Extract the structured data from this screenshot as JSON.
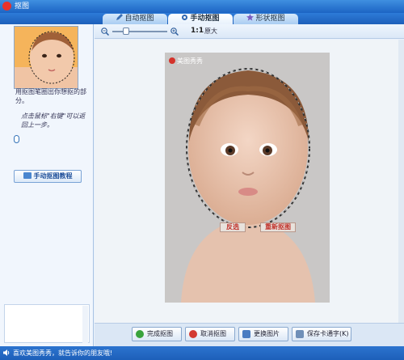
{
  "window": {
    "title": "抠图"
  },
  "tabs": [
    {
      "label": "自动抠图",
      "icon": "pen-icon"
    },
    {
      "label": "手动抠图",
      "icon": "hand-icon"
    },
    {
      "label": "形状抠图",
      "icon": "shape-icon"
    }
  ],
  "sidebar": {
    "hint_draw": "用抠图笔圈出你想抠的部分。",
    "hint_mouse": "点击鼠标\"右键\"可以返回上一步。",
    "tutorial_button": "手动抠图教程"
  },
  "toolbar": {
    "ratio": "1:1",
    "original": "原大"
  },
  "photo": {
    "watermark": "美图秀秀",
    "invert_button": "反选",
    "reset_button": "重新抠图"
  },
  "bottom": {
    "done_button": "完成抠图",
    "cancel_button": "取消抠图",
    "replace_button": "更换图片",
    "save_button": "保存卡通字(K)"
  },
  "status": {
    "text": "喜欢美图秀秀，就告诉你的朋友哦!"
  },
  "colors": {
    "title_blue": "#1c64c4",
    "accent_red": "#c0312a",
    "status_blue": "#1d5fb9"
  }
}
